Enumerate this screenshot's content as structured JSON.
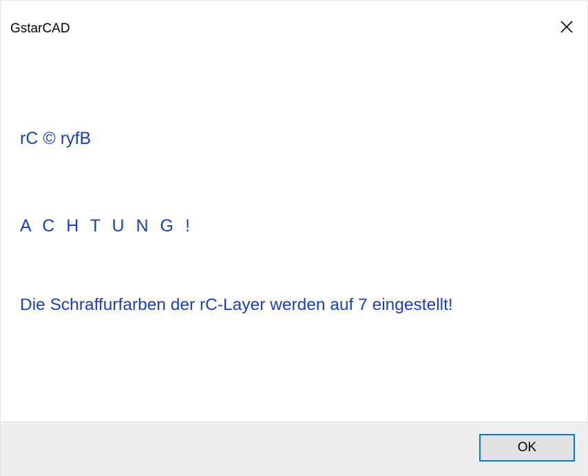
{
  "window": {
    "title": "GstarCAD"
  },
  "message": {
    "line1": "rC © ryfB",
    "line2": "A C H T U N G !",
    "line3": "Die Schraffurfarben der rC-Layer werden auf 7 eingestellt!"
  },
  "buttons": {
    "ok_label": "OK"
  },
  "icons": {
    "close": "close-icon"
  },
  "colors": {
    "message_text": "#1a3fbf",
    "footer_bg": "#efefef",
    "ok_border": "#0078d7"
  }
}
